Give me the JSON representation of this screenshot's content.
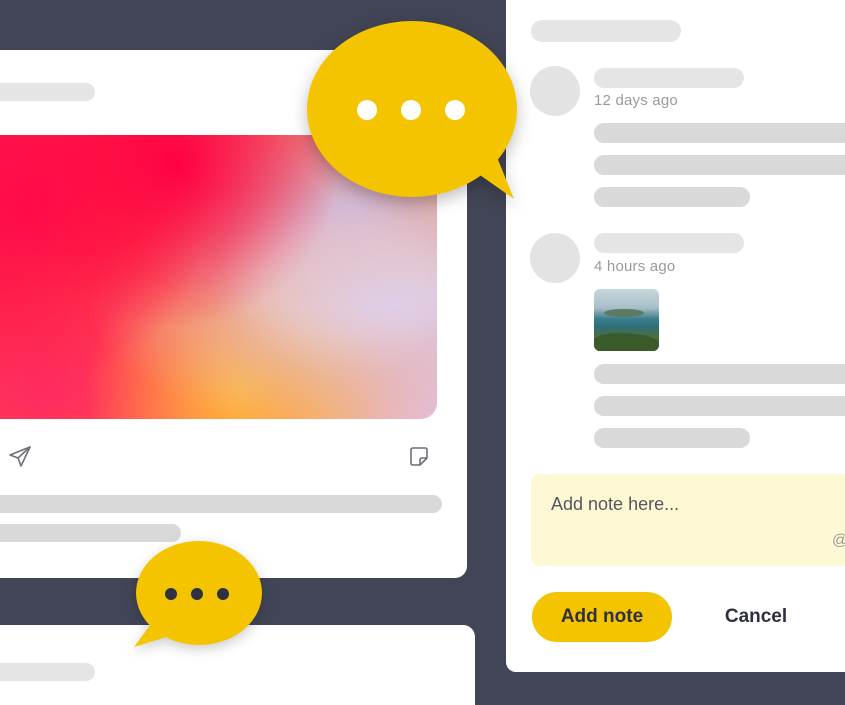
{
  "comments": [
    {
      "timestamp": "12 days ago"
    },
    {
      "timestamp": "4 hours ago",
      "has_image": true
    }
  ],
  "note": {
    "placeholder": "Add note here...",
    "mention_symbol": "@"
  },
  "actions": {
    "add_note_label": "Add note",
    "cancel_label": "Cancel"
  },
  "post": {
    "share_icon": "send-icon",
    "note_icon": "sticky-note-icon"
  },
  "colors": {
    "background": "#414555",
    "accent": "#f5c400",
    "note_background": "#fdf8d4"
  }
}
